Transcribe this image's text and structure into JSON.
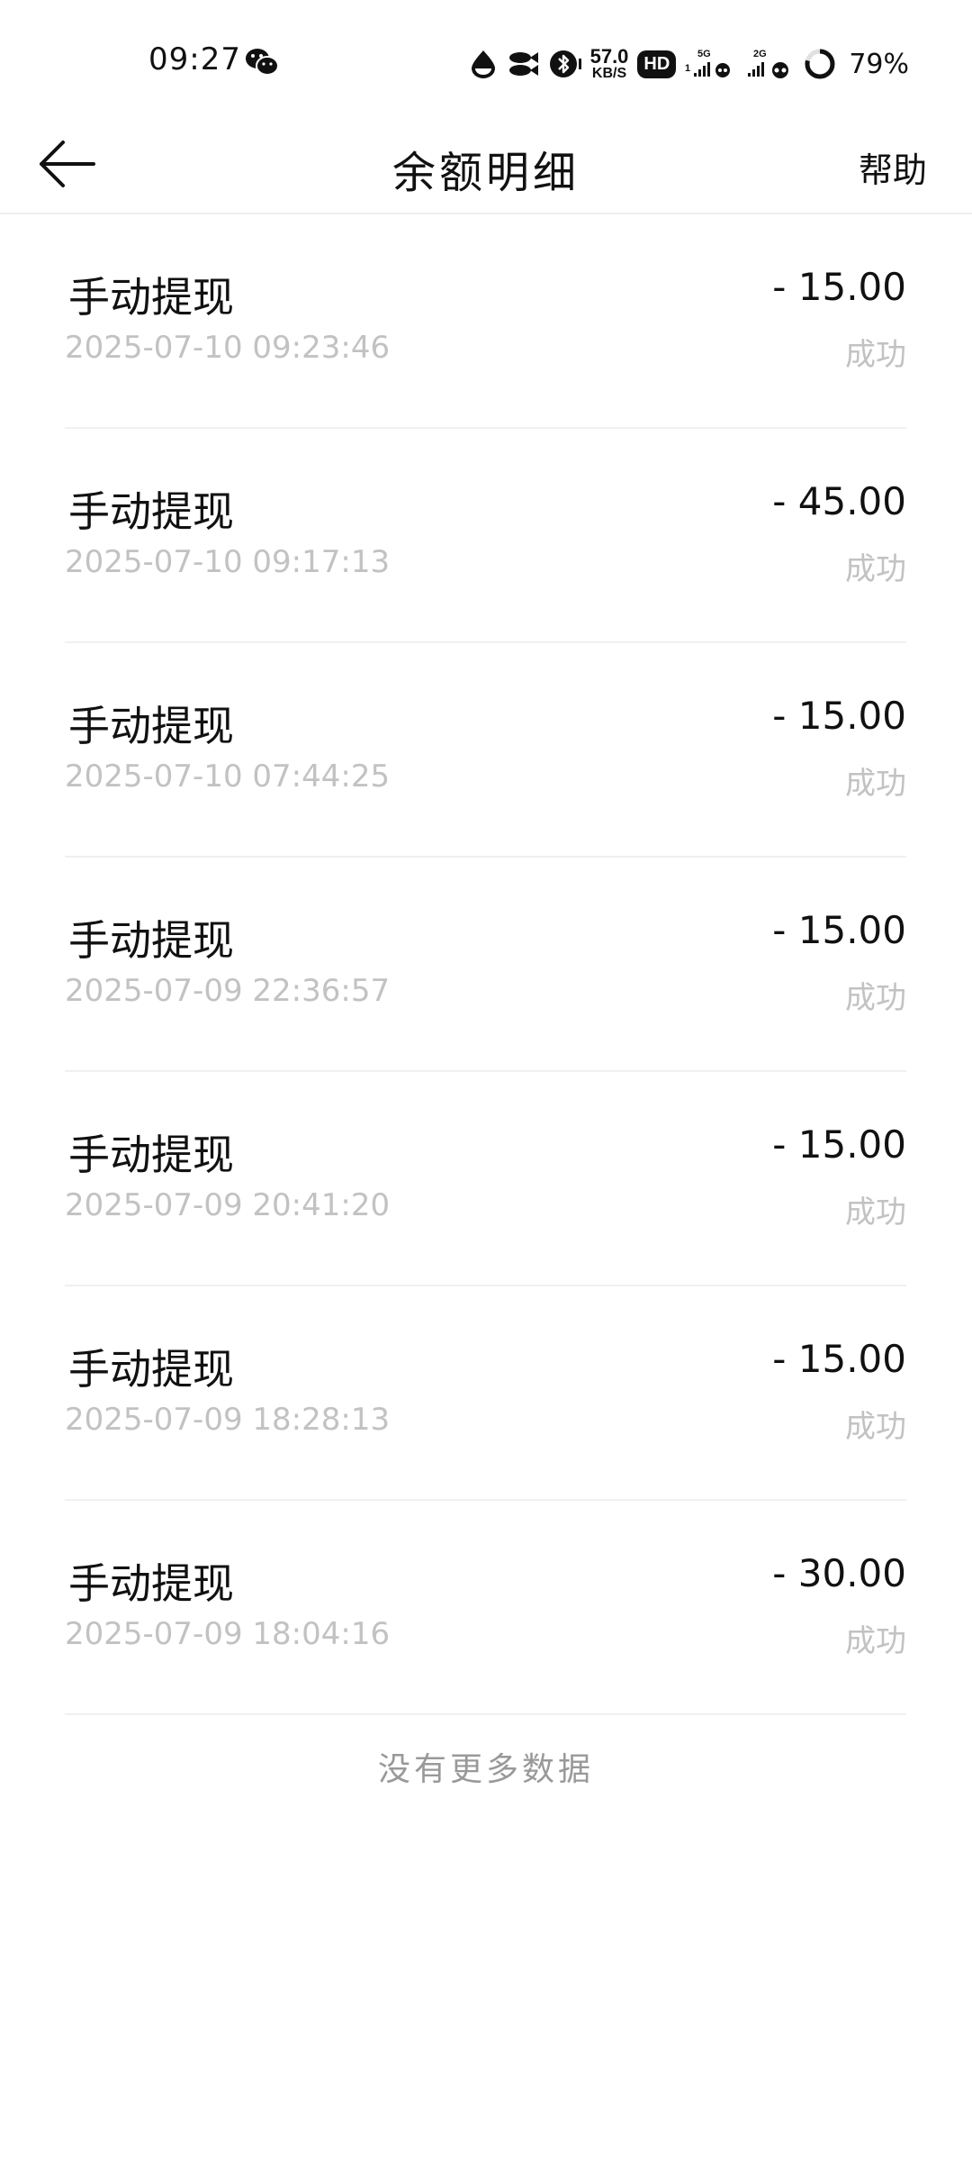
{
  "status_bar": {
    "time": "09:27",
    "net_speed_value": "57.0",
    "net_speed_unit": "KB/S",
    "hd": "HD",
    "sim1_label": "5G",
    "sim1_index": "1",
    "sim2_label": "2G",
    "battery": "79%",
    "icons": [
      "wechat-icon",
      "drop-icon",
      "fish-icon",
      "bluetooth-icon",
      "signal-icon",
      "battery-ring-icon"
    ]
  },
  "header": {
    "title": "余额明细",
    "help": "帮助"
  },
  "transactions": [
    {
      "title": "手动提现",
      "amount": "- 15.00",
      "time": "2025-07-10 09:23:46",
      "status": "成功"
    },
    {
      "title": "手动提现",
      "amount": "- 45.00",
      "time": "2025-07-10 09:17:13",
      "status": "成功"
    },
    {
      "title": "手动提现",
      "amount": "- 15.00",
      "time": "2025-07-10 07:44:25",
      "status": "成功"
    },
    {
      "title": "手动提现",
      "amount": "- 15.00",
      "time": "2025-07-09 22:36:57",
      "status": "成功"
    },
    {
      "title": "手动提现",
      "amount": "- 15.00",
      "time": "2025-07-09 20:41:20",
      "status": "成功"
    },
    {
      "title": "手动提现",
      "amount": "- 15.00",
      "time": "2025-07-09 18:28:13",
      "status": "成功"
    },
    {
      "title": "手动提现",
      "amount": "- 30.00",
      "time": "2025-07-09 18:04:16",
      "status": "成功"
    }
  ],
  "footer": {
    "no_more": "没有更多数据"
  }
}
